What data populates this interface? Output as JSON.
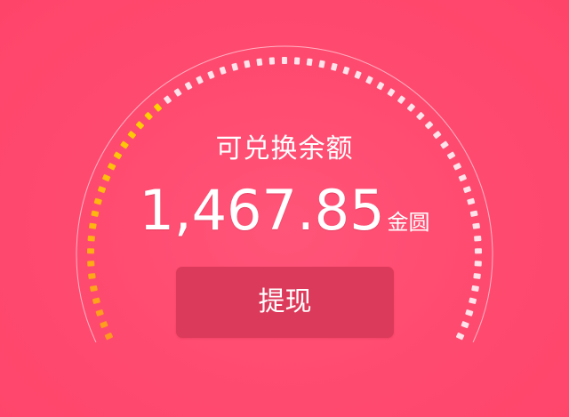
{
  "balance": {
    "label": "可兑换余额",
    "amount": "1,467.85",
    "unit": "金圆"
  },
  "actions": {
    "withdraw_label": "提现"
  },
  "gauge": {
    "progress": 0.33,
    "colors": {
      "filled": "#ffd400",
      "filled_end": "#ff9a1f",
      "remaining": "#ffe3ea",
      "outer_ring": "#ffd0da"
    }
  },
  "colors": {
    "background": "#ff4a6e",
    "button": "#dc3a5a",
    "text": "#ffffff"
  }
}
